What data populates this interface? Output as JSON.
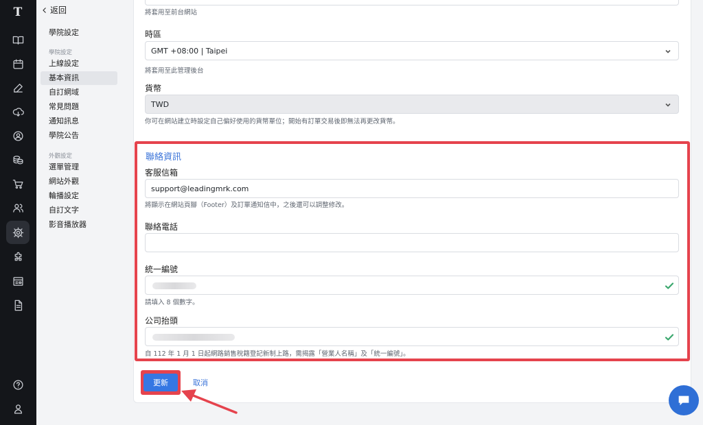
{
  "rail": {
    "logo": "T",
    "items": [
      "book-icon",
      "calendar-icon",
      "edit-icon",
      "download-cloud-icon",
      "user-circle-icon",
      "coins-icon",
      "cart-icon",
      "users-icon",
      "settings-icon",
      "puzzle-icon",
      "layout-icon",
      "file-icon"
    ],
    "bottom": [
      "help-icon",
      "account-icon"
    ]
  },
  "subnav": {
    "back_label": "返回",
    "school_settings": "學院設定",
    "group1": "學院設定",
    "group1_items": [
      "上線設定",
      "基本資訊",
      "自訂網域",
      "常見問題",
      "通知訊息",
      "學院公告"
    ],
    "group2": "外觀設定",
    "group2_items": [
      "選單管理",
      "網站外觀",
      "輪播設定",
      "自訂文字",
      "影音播放器"
    ],
    "active_item": "基本資訊"
  },
  "form": {
    "top_hint": "將套用至前台網站",
    "timezone": {
      "label": "時區",
      "value": "GMT +08:00 | Taipei",
      "hint": "將套用至此管理後台"
    },
    "currency": {
      "label": "貨幣",
      "value": "TWD",
      "hint": "你可在網站建立時設定自己偏好使用的貨幣單位；開始有訂單交易後即無法再更改貨幣。"
    },
    "contact": {
      "title": "聯絡資訊",
      "email_label": "客服信箱",
      "email_value": "support@leadingmrk.com",
      "email_hint": "將顯示在網站頁腳（Footer）及訂單通知信中，之後還可以調整修改。",
      "phone_label": "聯絡電話",
      "phone_value": "",
      "tax_id_label": "統一編號",
      "tax_id_hint": "請填入 8 個數字。",
      "company_label": "公司抬頭",
      "company_hint": "自 112 年 1 月 1 日起網路銷售稅籍登記新制上路，需揭露「營業人名稱」及「統一編號」。"
    },
    "update_label": "更新",
    "cancel_label": "取消"
  },
  "colors": {
    "accent": "#3577e3",
    "highlight": "#e5434d",
    "valid": "#3aa76d",
    "rail": "#14161a"
  }
}
